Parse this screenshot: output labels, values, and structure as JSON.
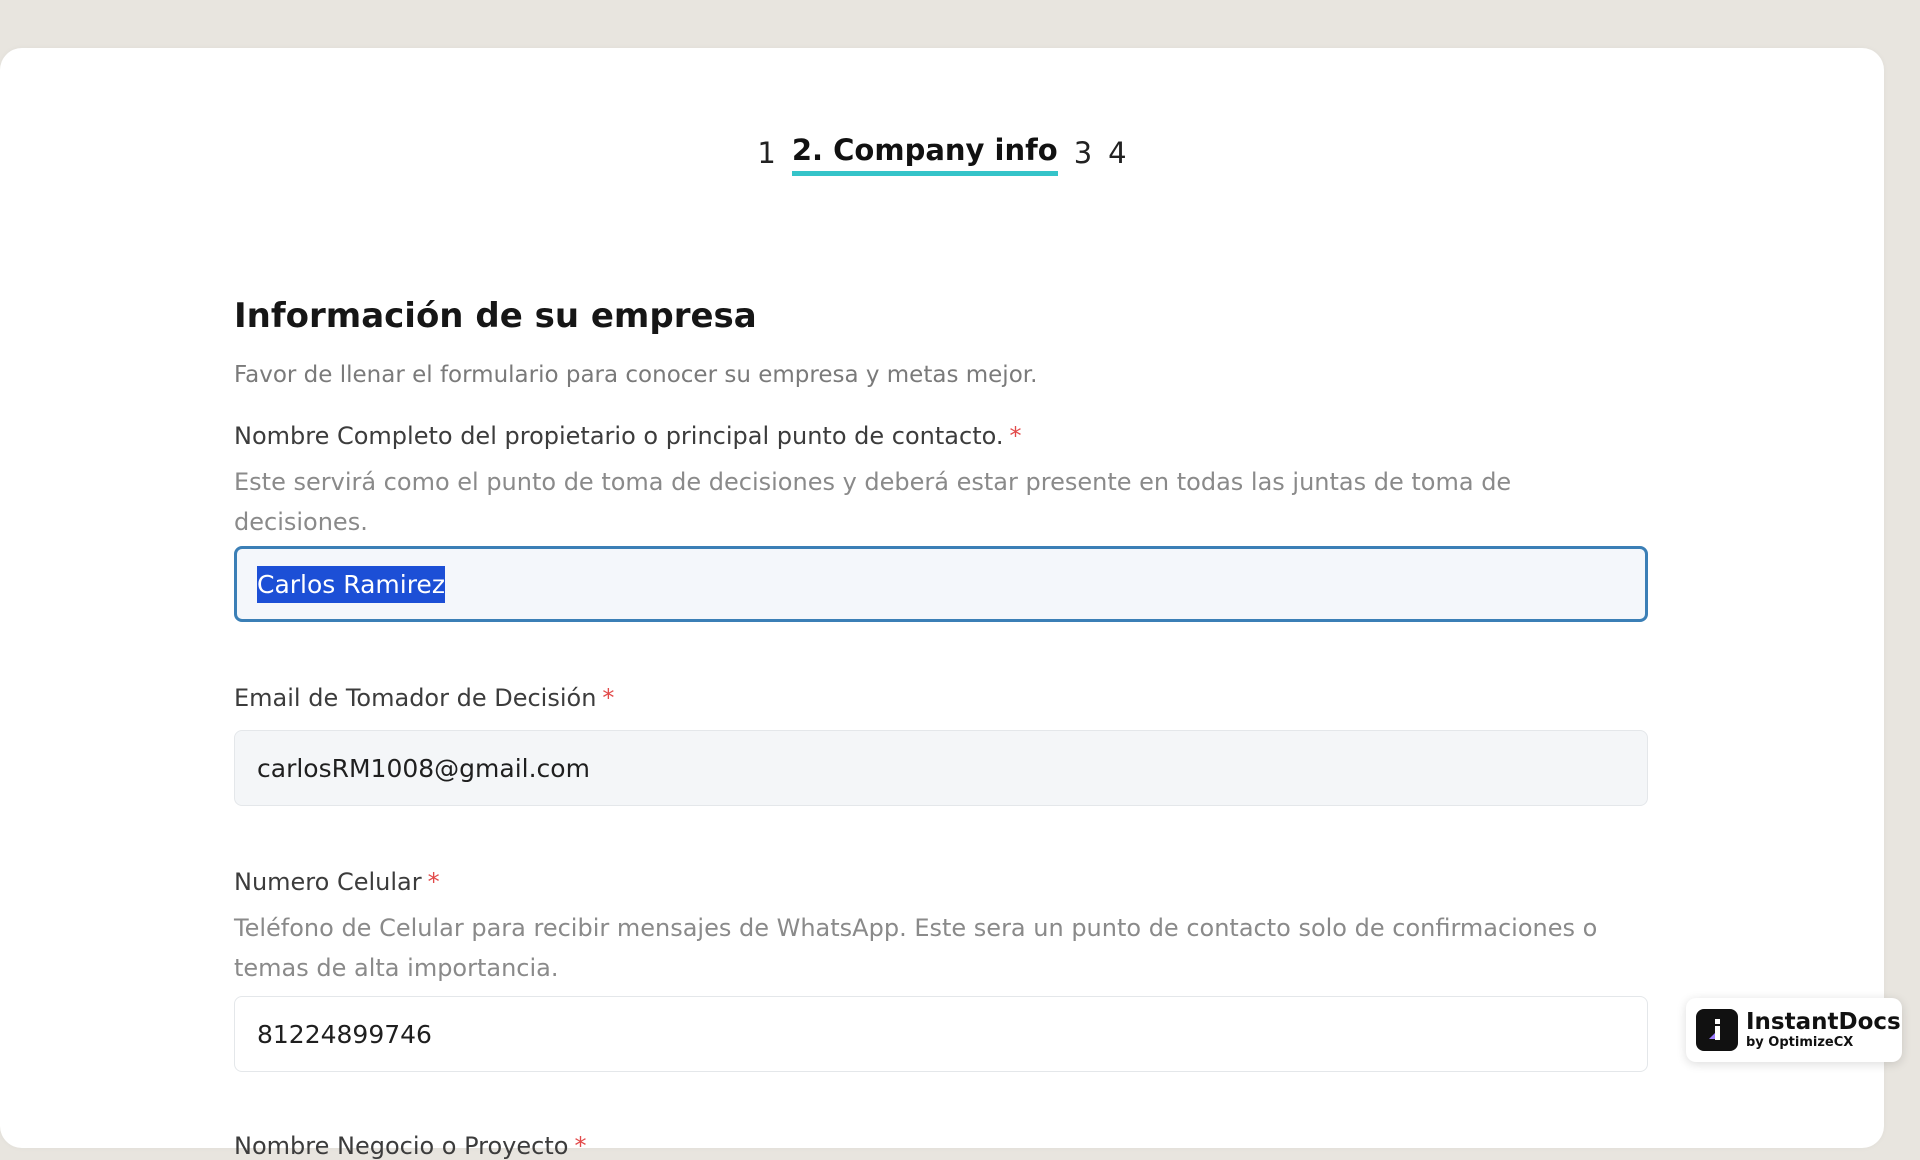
{
  "stepper": {
    "steps": [
      {
        "label": "1",
        "active": false
      },
      {
        "label": "2. Company info",
        "active": true
      },
      {
        "label": "3",
        "active": false
      },
      {
        "label": "4",
        "active": false
      }
    ],
    "accent_color": "#35c4c9"
  },
  "form": {
    "title": "Información de su empresa",
    "subtitle": "Favor de llenar el formulario para conocer su empresa y metas mejor.",
    "required_marker": "*",
    "owner": {
      "label": "Nombre Completo del propietario o principal punto de contacto.",
      "help": "Este servirá como el punto de toma de decisiones y deberá estar presente en todas las juntas de toma de decisiones.",
      "value": "Carlos Ramirez"
    },
    "email": {
      "label": "Email de Tomador de Decisión",
      "value": "carlosRM1008@gmail.com"
    },
    "phone": {
      "label": "Numero Celular",
      "help": "Teléfono de Celular para recibir mensajes de WhatsApp. Este sera un punto de contacto solo de confirmaciones o temas de alta importancia.",
      "value": "81224899746"
    },
    "business": {
      "label": "Nombre Negocio o Proyecto"
    }
  },
  "badge": {
    "name": "InstantDocs",
    "by": "by OptimizeCX",
    "icon": "instantdocs-logo-icon"
  }
}
